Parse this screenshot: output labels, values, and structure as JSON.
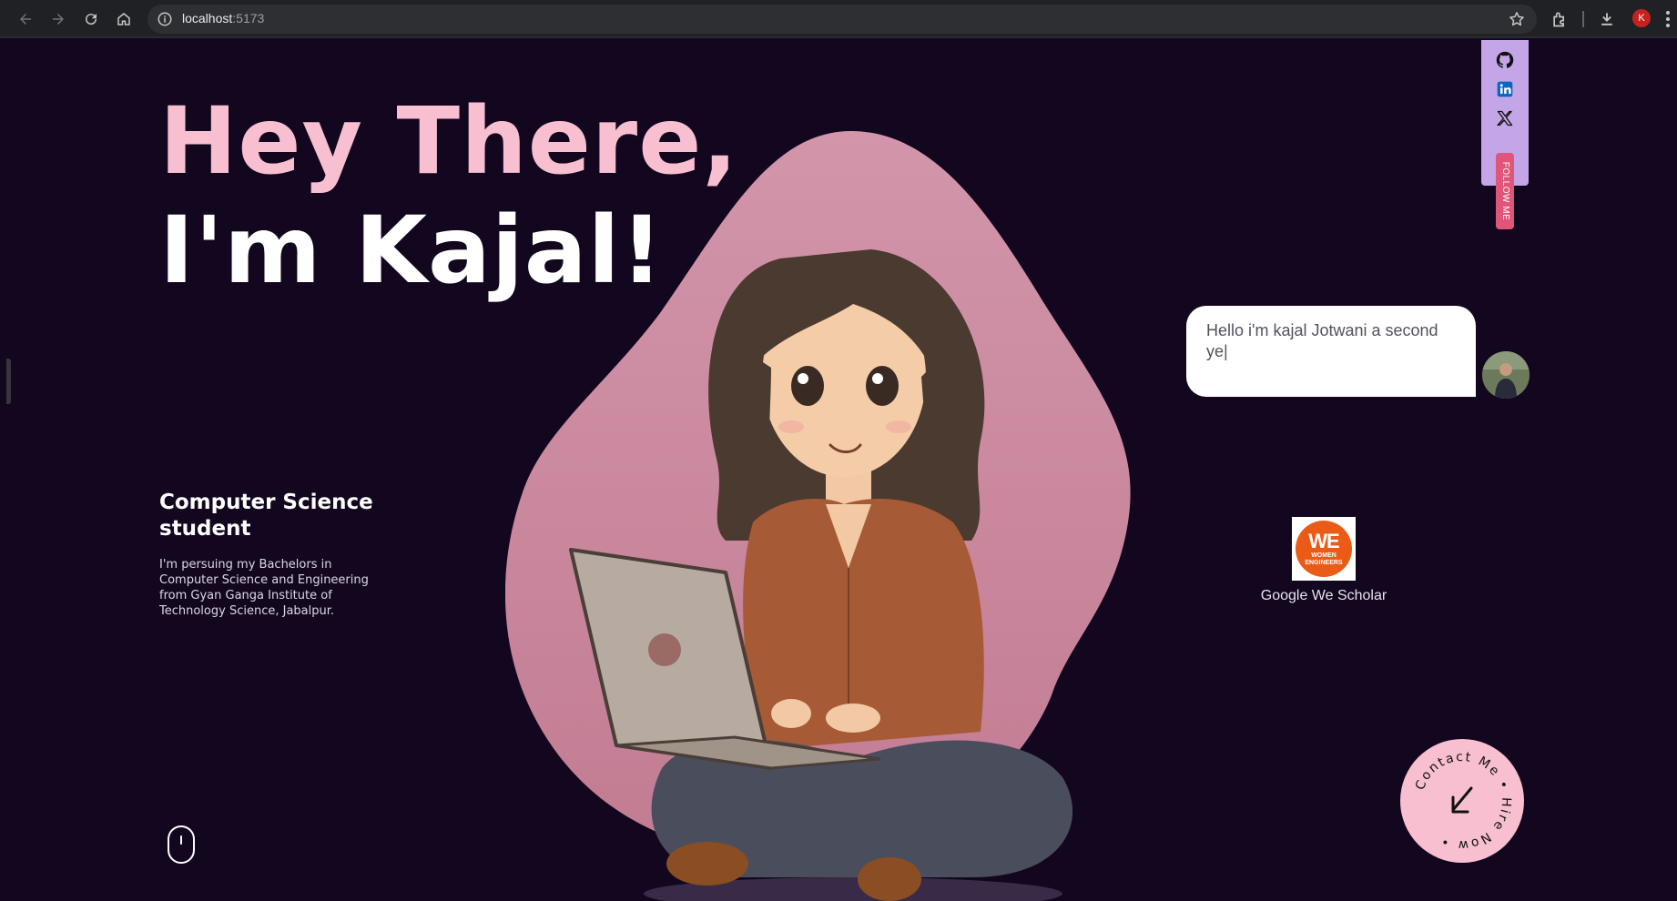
{
  "browser": {
    "url_host": "localhost",
    "url_port": ":5173",
    "profile_initial": "K",
    "icons": [
      "back-icon",
      "forward-icon",
      "reload-icon",
      "home-icon",
      "info-icon",
      "star-icon",
      "extensions-icon",
      "download-icon",
      "menu-icon"
    ]
  },
  "hero": {
    "line1": "Hey There,",
    "line2": "I'm Kajal!"
  },
  "intro": {
    "title": "Computer Science student",
    "description": "I'm persuing my Bachelors in Computer Science and Engineering from Gyan Ganga Institute of Technology Science, Jabalpur."
  },
  "social": {
    "icons": [
      "github-icon",
      "linkedin-icon",
      "x-twitter-icon"
    ],
    "follow_label": "FOLLOW ME"
  },
  "chat": {
    "bubble_text": "Hello i'm kajal Jotwani a second ye|"
  },
  "badge": {
    "logo_main": "WE",
    "logo_sub_1": "WOMEN",
    "logo_sub_2": "ENGINEERS",
    "label": "Google We Scholar"
  },
  "contact": {
    "ring_text": "Contact Me • Hire Now •"
  },
  "colors": {
    "background": "#12071f",
    "accent_pink": "#f8bfd0",
    "blob": "#d08ea2",
    "social_bar": "#c4a6e8",
    "follow_tag": "#e0557a"
  }
}
